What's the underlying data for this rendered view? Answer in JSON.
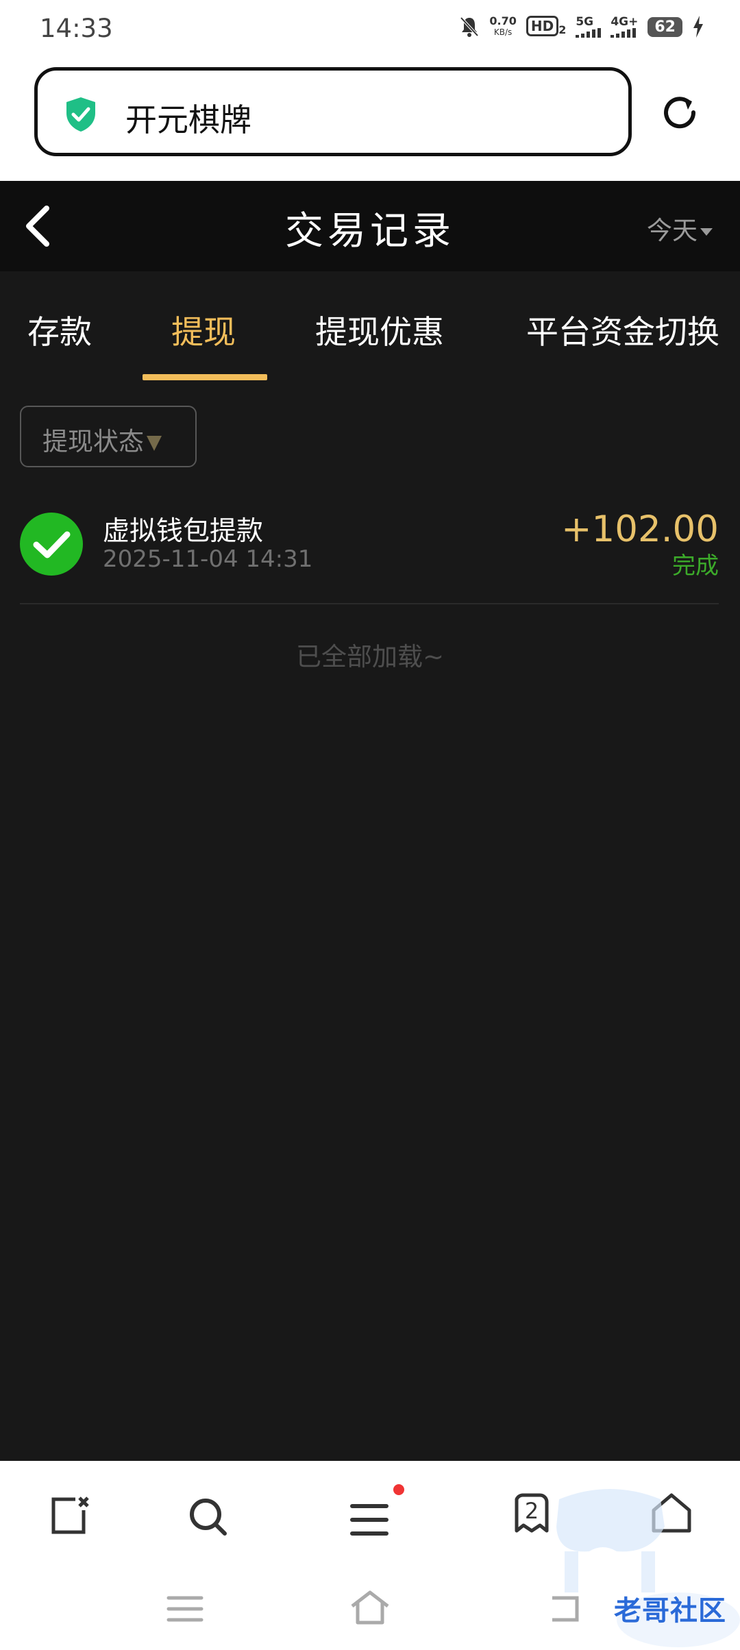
{
  "status_bar": {
    "time": "14:33",
    "net_speed_value": "0.70",
    "net_speed_unit": "KB/s",
    "hd_label": "HD",
    "hd_sub": "2",
    "net1": "5G",
    "net2": "4G+",
    "battery": "62"
  },
  "browser": {
    "url_text": "开元棋牌"
  },
  "header": {
    "title": "交易记录",
    "date_filter": "今天"
  },
  "tabs": [
    {
      "label": "存款",
      "active": false
    },
    {
      "label": "提现",
      "active": true
    },
    {
      "label": "提现优惠",
      "active": false
    },
    {
      "label": "平台资金切换",
      "active": false
    }
  ],
  "filter": {
    "label": "提现状态"
  },
  "transactions": [
    {
      "title": "虚拟钱包提款",
      "datetime": "2025-11-04 14:31",
      "amount": "+102.00",
      "status": "完成"
    }
  ],
  "list_end_text": "已全部加载~",
  "browser_nav": {
    "tab_count": "2"
  },
  "watermark": {
    "text": "老哥社区"
  },
  "colors": {
    "accent": "#f2bd5a",
    "success": "#22b823",
    "background": "#181818"
  }
}
